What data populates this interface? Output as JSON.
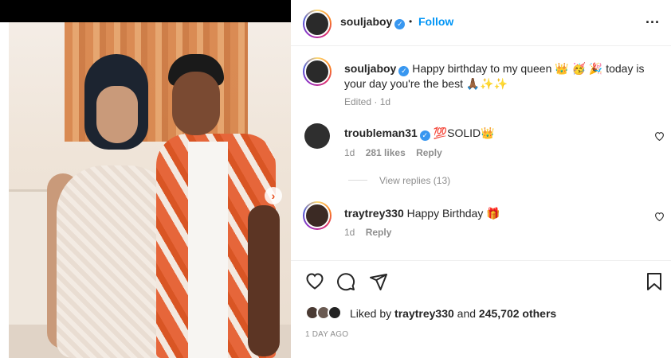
{
  "post_author": {
    "username": "souljaboy",
    "verified_mark": "✓",
    "separator": "•",
    "follow_label": "Follow",
    "more_label": "..."
  },
  "caption": {
    "username": "souljaboy",
    "text": "Happy birthday to my queen 👑 🥳 🎉 today is your day you're the best 🙏🏾✨✨",
    "meta": "Edited · 1d"
  },
  "comments": [
    {
      "username": "troubleman31",
      "text": "💯SOLID👑",
      "time": "1d",
      "likes": "281 likes",
      "reply_label": "Reply",
      "view_replies": "View replies (13)"
    },
    {
      "username": "traytrey330",
      "text": "Happy Birthday 🎁",
      "time": "1d",
      "reply_label": "Reply"
    }
  ],
  "likes": {
    "prefix": "Liked by",
    "first_user": "traytrey330",
    "joiner": "and",
    "count": "245,702 others"
  },
  "post_date": "1 DAY AGO",
  "icons": {
    "like": "heart-icon",
    "comment": "comment-icon",
    "share": "send-icon",
    "save": "bookmark-icon",
    "next": "chevron-right-icon",
    "more": "more-options-icon"
  },
  "colors": {
    "accent": "#0095f6",
    "verified": "#3897f0",
    "muted": "#8e8e8e"
  }
}
